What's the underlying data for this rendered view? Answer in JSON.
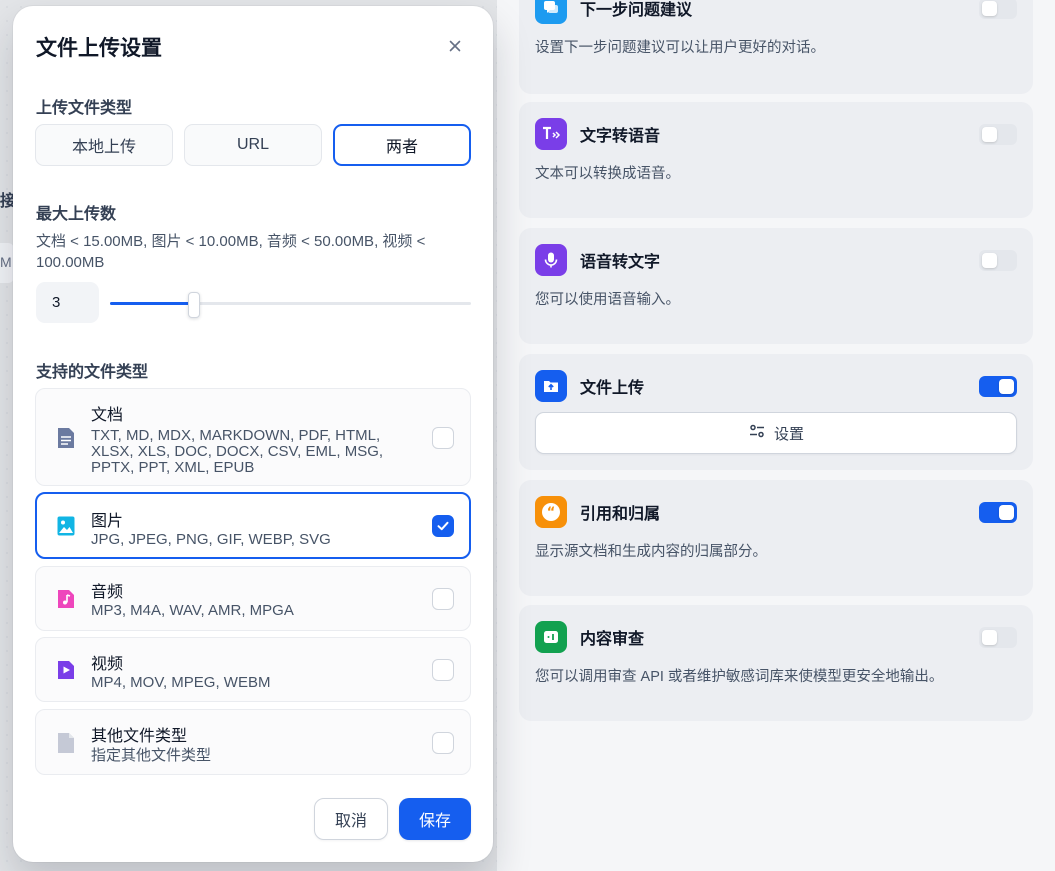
{
  "background": {
    "peek_char": "接",
    "peek_unit": "M"
  },
  "right_panel": {
    "features": [
      {
        "title": "下一步问题建议",
        "desc": "设置下一步问题建议可以让用户更好的对话。",
        "enabled": false,
        "icon": "chat-bubble-icon",
        "icon_color": "#1d9bf0"
      },
      {
        "title": "文字转语音",
        "desc": "文本可以转换成语音。",
        "enabled": false,
        "icon": "text-to-speech-icon",
        "icon_color": "#7a3ee8"
      },
      {
        "title": "语音转文字",
        "desc": "您可以使用语音输入。",
        "enabled": false,
        "icon": "microphone-icon",
        "icon_color": "#7a3ee8"
      },
      {
        "title": "文件上传",
        "settings_label": "设置",
        "enabled": true,
        "icon": "folder-upload-icon",
        "icon_color": "#155eef"
      },
      {
        "title": "引用和归属",
        "desc": "显示源文档和生成内容的归属部分。",
        "enabled": true,
        "icon": "quote-icon",
        "icon_color": "#f79009"
      },
      {
        "title": "内容审查",
        "desc": "您可以调用审查 API 或者维护敏感词库来使模型更安全地输出。",
        "enabled": false,
        "icon": "moderation-icon",
        "icon_color": "#12a150"
      }
    ]
  },
  "modal": {
    "title": "文件上传设置",
    "upload_type": {
      "label": "上传文件类型",
      "options": [
        "本地上传",
        "URL",
        "两者"
      ],
      "selected": "两者"
    },
    "max_uploads": {
      "label": "最大上传数",
      "limits": "文档 < 15.00MB, 图片 < 10.00MB, 音频 < 50.00MB, 视频 < 100.00MB",
      "value": "3",
      "slider_fraction": 0.233
    },
    "file_types": {
      "label": "支持的文件类型",
      "items": [
        {
          "name": "文档",
          "exts": "TXT, MD, MDX, MARKDOWN, PDF, HTML, XLSX, XLS, DOC, DOCX, CSV, EML, MSG, PPTX, PPT, XML, EPUB",
          "checked": false,
          "icon": "document-icon",
          "color": "#6b7aa0"
        },
        {
          "name": "图片",
          "exts": "JPG, JPEG, PNG, GIF, WEBP, SVG",
          "checked": true,
          "icon": "image-icon",
          "color": "#11b5e4"
        },
        {
          "name": "音频",
          "exts": "MP3, M4A, WAV, AMR, MPGA",
          "checked": false,
          "icon": "audio-icon",
          "color": "#ee46bc"
        },
        {
          "name": "视频",
          "exts": "MP4, MOV, MPEG, WEBM",
          "checked": false,
          "icon": "video-icon",
          "color": "#7a3ee8"
        },
        {
          "name": "其他文件类型",
          "exts": "指定其他文件类型",
          "checked": false,
          "icon": "file-icon",
          "color": "#c5c9d6"
        }
      ]
    },
    "cancel_label": "取消",
    "save_label": "保存",
    "accent": "#155eef"
  }
}
